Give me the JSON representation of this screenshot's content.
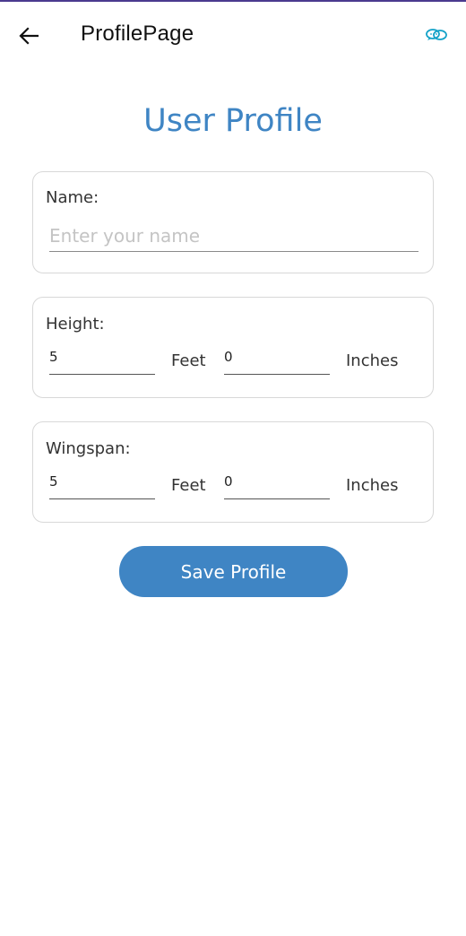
{
  "appbar": {
    "back_icon": "arrow-left-icon",
    "title": "ProfilePage",
    "hotreload_icon": "hot-reload-icon",
    "accent": "#14a2c8"
  },
  "page": {
    "title": "User Profile",
    "title_color": "#3f85c4"
  },
  "name_card": {
    "label": "Name:",
    "placeholder": "Enter your name",
    "value": ""
  },
  "height_card": {
    "label": "Height:",
    "feet_value": "5",
    "feet_unit": "Feet",
    "inches_value": "0",
    "inches_unit": "Inches"
  },
  "wingspan_card": {
    "label": "Wingspan:",
    "feet_value": "5",
    "feet_unit": "Feet",
    "inches_value": "0",
    "inches_unit": "Inches"
  },
  "actions": {
    "save_label": "Save Profile",
    "button_color": "#3f85c4"
  }
}
